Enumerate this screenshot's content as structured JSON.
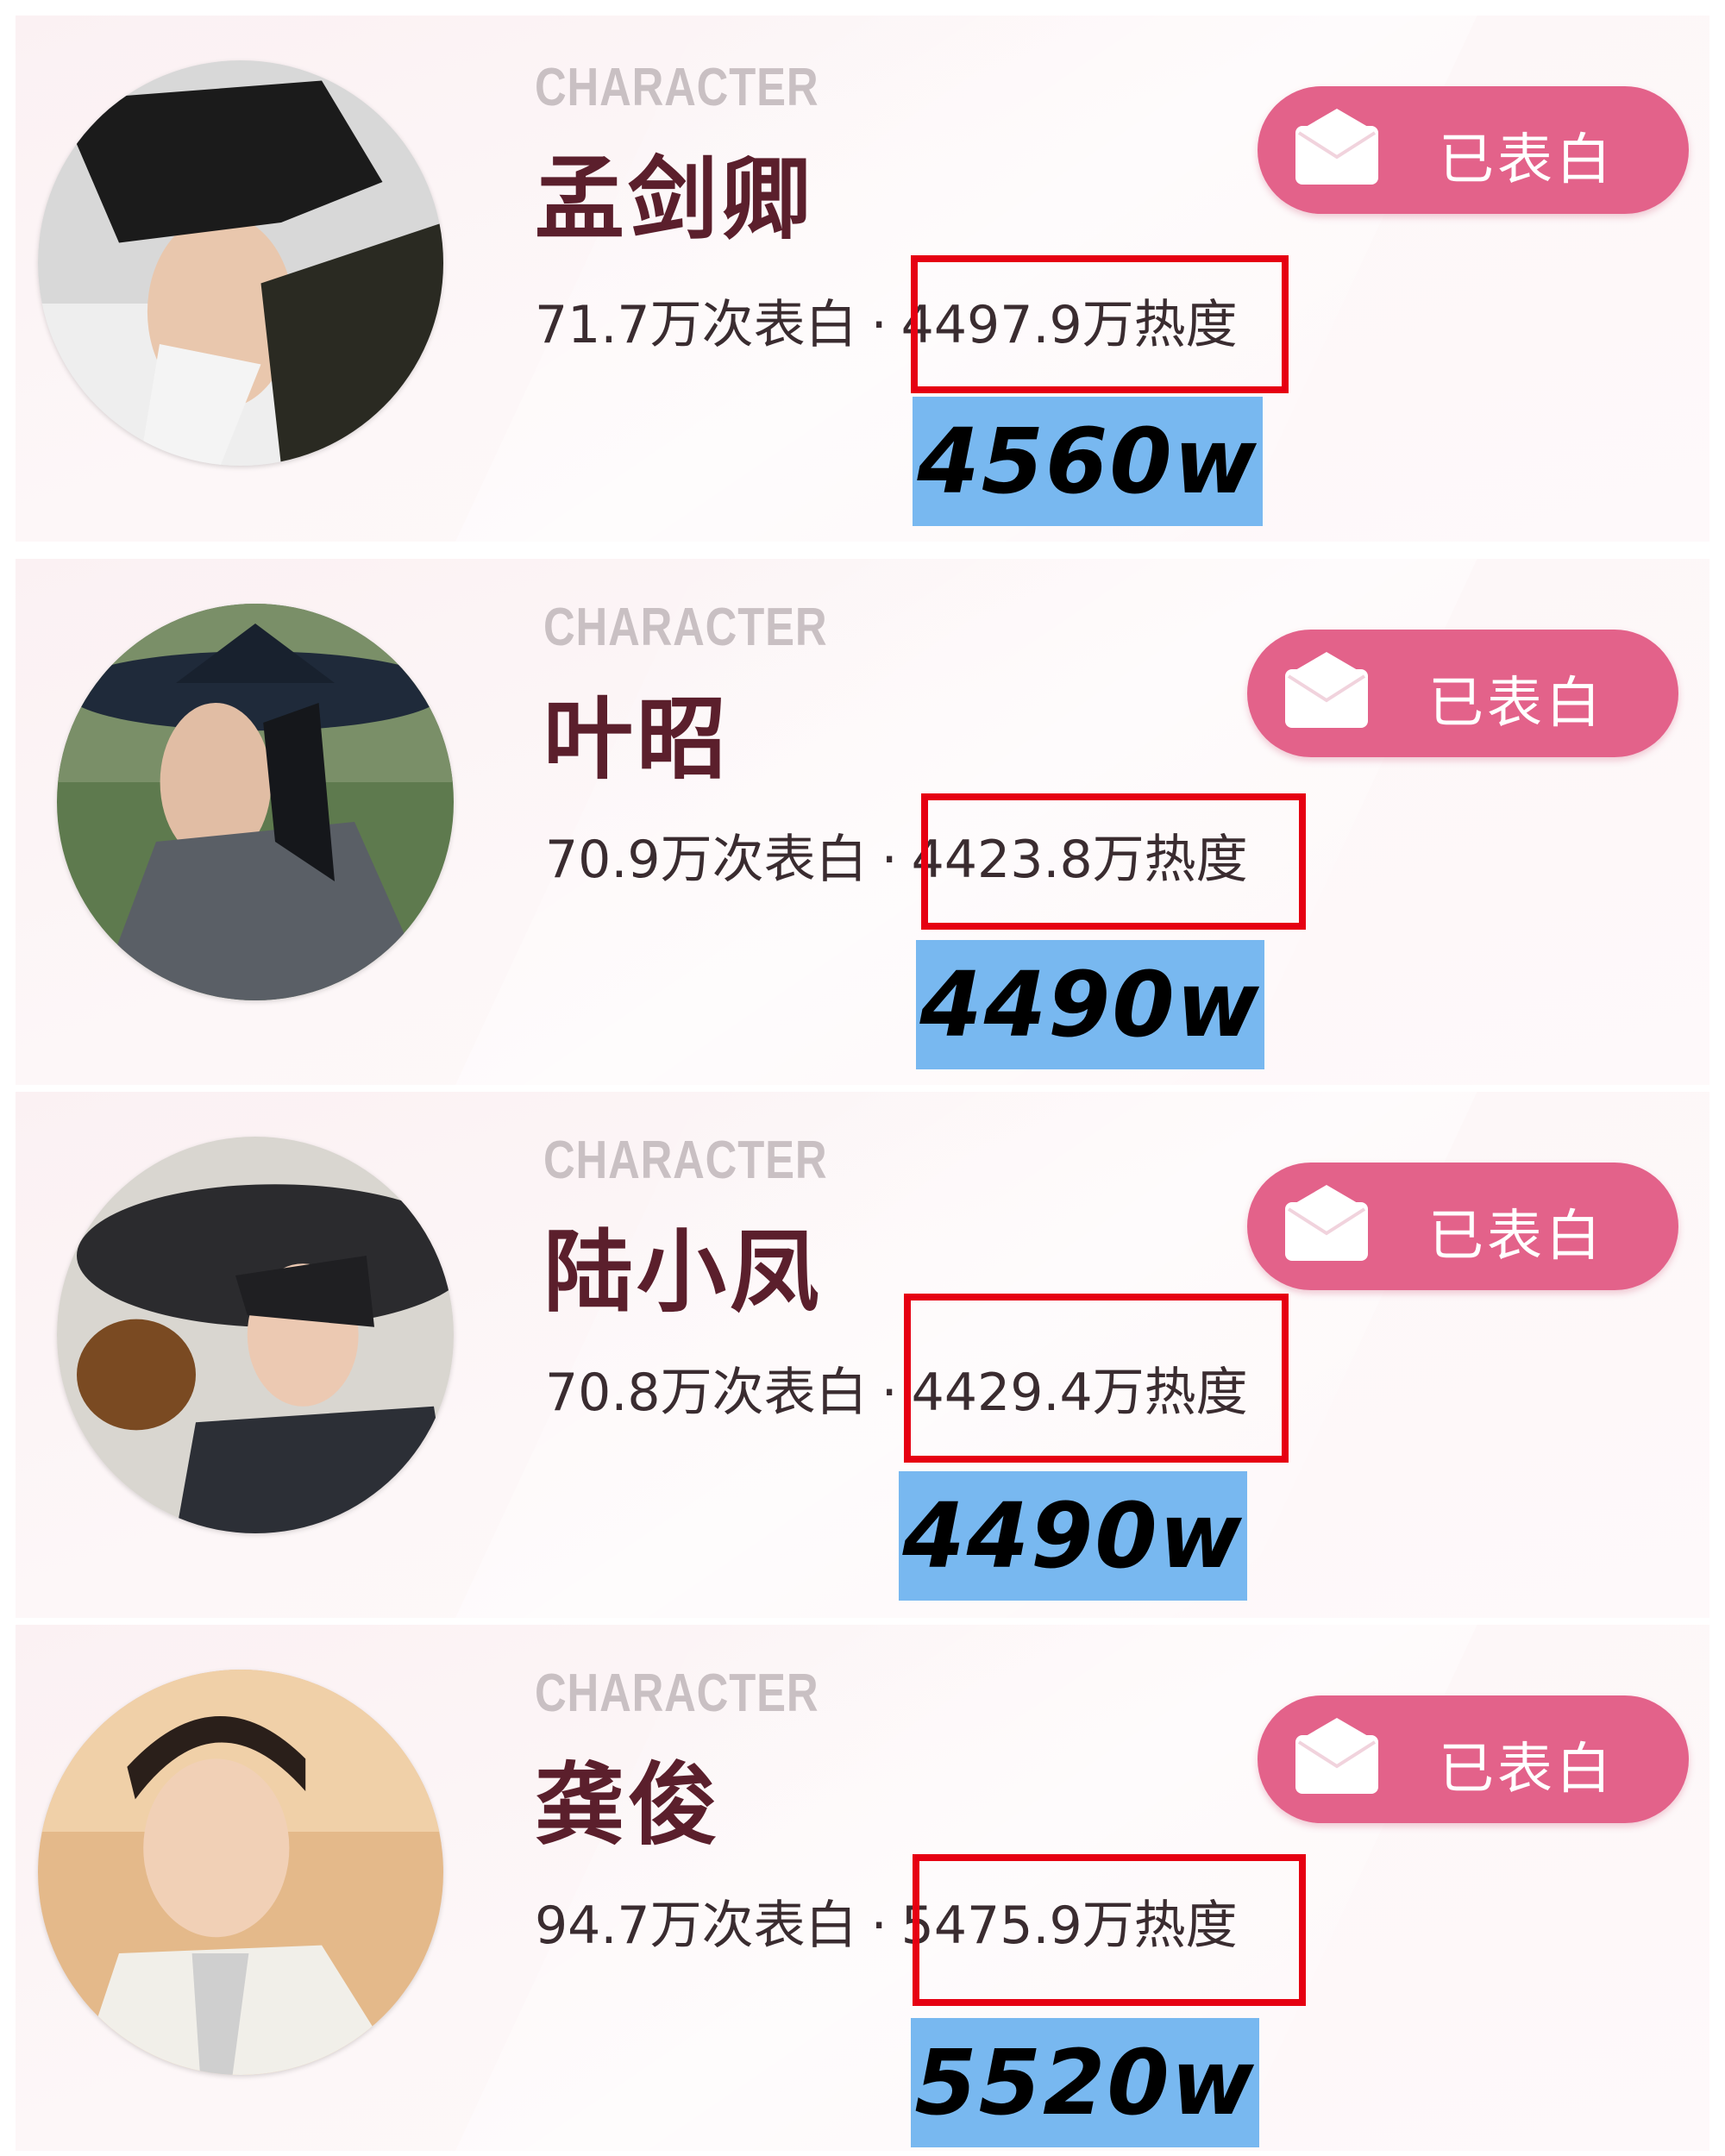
{
  "cards": [
    {
      "tag": "CHARACTER",
      "name": "孟剑卿",
      "confess_button": "已表白",
      "confessions": "71.7万次表白",
      "separator": "·",
      "heat": "4497.9万热度",
      "estimate": "4560w"
    },
    {
      "tag": "CHARACTER",
      "name": "叶昭",
      "confess_button": "已表白",
      "confessions": "70.9万次表白",
      "separator": "·",
      "heat": "4423.8万热度",
      "estimate": "4490w"
    },
    {
      "tag": "CHARACTER",
      "name": "陆小凤",
      "confess_button": "已表白",
      "confessions": "70.8万次表白",
      "separator": "·",
      "heat": "4429.4万热度",
      "estimate": "4490w"
    },
    {
      "tag": "CHARACTER",
      "name": "龚俊",
      "confess_button": "已表白",
      "confessions": "94.7万次表白",
      "separator": "·",
      "heat": "5475.9万热度",
      "estimate": "5520w"
    }
  ],
  "colors": {
    "button": "#e3628a",
    "name": "#5b1f2c",
    "highlight_box": "#e60012",
    "estimate_bg": "#78b8f0"
  },
  "icons": [
    "envelope-icon",
    "avatar-image"
  ]
}
